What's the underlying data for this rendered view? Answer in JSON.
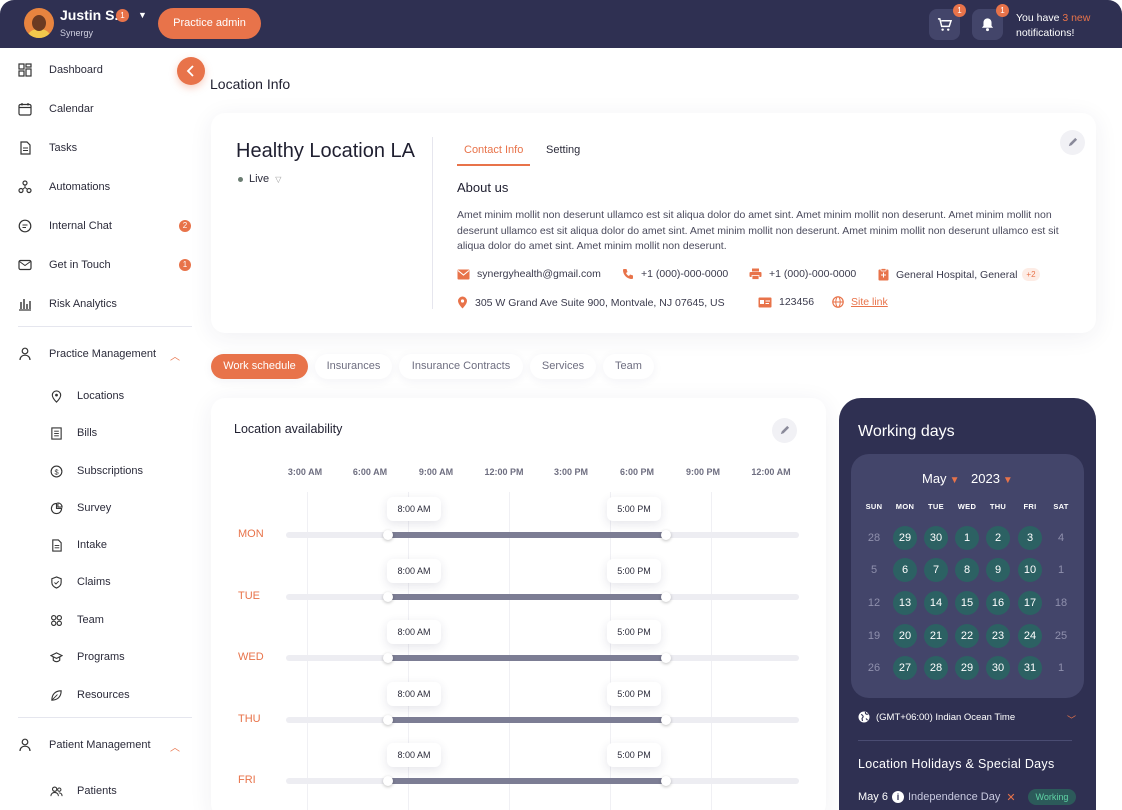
{
  "user": {
    "name": "Justin S.",
    "badge": "1",
    "org": "Synergy"
  },
  "header": {
    "practice_button": "Practice admin",
    "cart_badge": "1",
    "bell_badge": "1",
    "notif_prefix": "You have",
    "notif_highlight": "3 new",
    "notif_suffix": "notifications!"
  },
  "sidebar": {
    "items": [
      {
        "label": "Dashboard",
        "icon": "dashboard-icon"
      },
      {
        "label": "Calendar",
        "icon": "calendar-icon"
      },
      {
        "label": "Tasks",
        "icon": "tasks-icon"
      },
      {
        "label": "Automations",
        "icon": "automations-icon"
      },
      {
        "label": "Internal Chat",
        "icon": "chat-icon",
        "count": "2"
      },
      {
        "label": "Get in Touch",
        "icon": "mail-icon",
        "count": "1"
      },
      {
        "label": "Risk Analytics",
        "icon": "analytics-icon"
      }
    ],
    "practice_management": {
      "label": "Practice Management",
      "children": [
        "Locations",
        "Bills",
        "Subscriptions",
        "Survey",
        "Intake",
        "Claims",
        "Team",
        "Programs",
        "Resources"
      ]
    },
    "patient_management": {
      "label": "Patient Management",
      "children": [
        "Patients"
      ]
    }
  },
  "page": {
    "title": "Location Info"
  },
  "location": {
    "name": "Healthy Location LA",
    "status": "Live",
    "tabs": [
      "Contact Info",
      "Setting"
    ],
    "about_title": "About us",
    "about_text": "Amet minim mollit non deserunt ullamco est sit aliqua dolor do amet sint. Amet minim mollit non deserunt. Amet minim mollit non deserunt ullamco est sit aliqua dolor do amet sint. Amet minim mollit non deserunt. Amet minim mollit non deserunt ullamco est sit aliqua dolor do amet sint. Amet minim mollit non deserunt.",
    "email": "synergyhealth@gmail.com",
    "phone": "+1 (000)-000-0000",
    "fax": "+1 (000)-000-0000",
    "facility": "General Hospital, General",
    "facility_more": "+2",
    "address": "305 W Grand Ave Suite 900, Montvale, NJ 07645, US",
    "license": "123456",
    "site_link": "Site link"
  },
  "section_tabs": [
    "Work schedule",
    "Insurances",
    "Insurance Contracts",
    "Services",
    "Team"
  ],
  "availability": {
    "title": "Location availability",
    "time_labels": [
      "3:00 AM",
      "6:00 AM",
      "9:00 AM",
      "12:00 PM",
      "3:00 PM",
      "6:00 PM",
      "9:00 PM",
      "12:00 AM"
    ],
    "rows": [
      {
        "day": "MON",
        "start": "8:00 AM",
        "end": "5:00 PM"
      },
      {
        "day": "TUE",
        "start": "8:00 AM",
        "end": "5:00 PM"
      },
      {
        "day": "WED",
        "start": "8:00 AM",
        "end": "5:00 PM"
      },
      {
        "day": "THU",
        "start": "8:00 AM",
        "end": "5:00 PM"
      },
      {
        "day": "FRI",
        "start": "8:00 AM",
        "end": "5:00 PM"
      }
    ]
  },
  "working_days": {
    "title": "Working days",
    "month": "May",
    "year": "2023",
    "weekdays": [
      "SUN",
      "MON",
      "TUE",
      "WED",
      "THU",
      "FRI",
      "SAT"
    ],
    "weeks": [
      [
        {
          "d": "28",
          "on": false
        },
        {
          "d": "29",
          "on": true
        },
        {
          "d": "30",
          "on": true
        },
        {
          "d": "1",
          "on": true
        },
        {
          "d": "2",
          "on": true
        },
        {
          "d": "3",
          "on": true
        },
        {
          "d": "4",
          "on": false
        }
      ],
      [
        {
          "d": "5",
          "on": false
        },
        {
          "d": "6",
          "on": true
        },
        {
          "d": "7",
          "on": true
        },
        {
          "d": "8",
          "on": true
        },
        {
          "d": "9",
          "on": true
        },
        {
          "d": "10",
          "on": true
        },
        {
          "d": "1",
          "on": false
        }
      ],
      [
        {
          "d": "12",
          "on": false
        },
        {
          "d": "13",
          "on": true
        },
        {
          "d": "14",
          "on": true
        },
        {
          "d": "15",
          "on": true
        },
        {
          "d": "16",
          "on": true
        },
        {
          "d": "17",
          "on": true
        },
        {
          "d": "18",
          "on": false
        }
      ],
      [
        {
          "d": "19",
          "on": false
        },
        {
          "d": "20",
          "on": true
        },
        {
          "d": "21",
          "on": true
        },
        {
          "d": "22",
          "on": true
        },
        {
          "d": "23",
          "on": true
        },
        {
          "d": "24",
          "on": true
        },
        {
          "d": "25",
          "on": false
        }
      ],
      [
        {
          "d": "26",
          "on": false
        },
        {
          "d": "27",
          "on": true
        },
        {
          "d": "28",
          "on": true
        },
        {
          "d": "29",
          "on": true
        },
        {
          "d": "30",
          "on": true
        },
        {
          "d": "31",
          "on": true
        },
        {
          "d": "1",
          "on": false
        }
      ]
    ],
    "timezone": "(GMT+06:00) Indian Ocean Time",
    "holidays_title": "Location Holidays & Special Days",
    "holiday": {
      "date": "May 6",
      "name": "Independence Day",
      "status": "Working"
    }
  },
  "colors": {
    "accent": "#e8734a",
    "navy": "#2f3052",
    "teal": "#2c6163"
  }
}
